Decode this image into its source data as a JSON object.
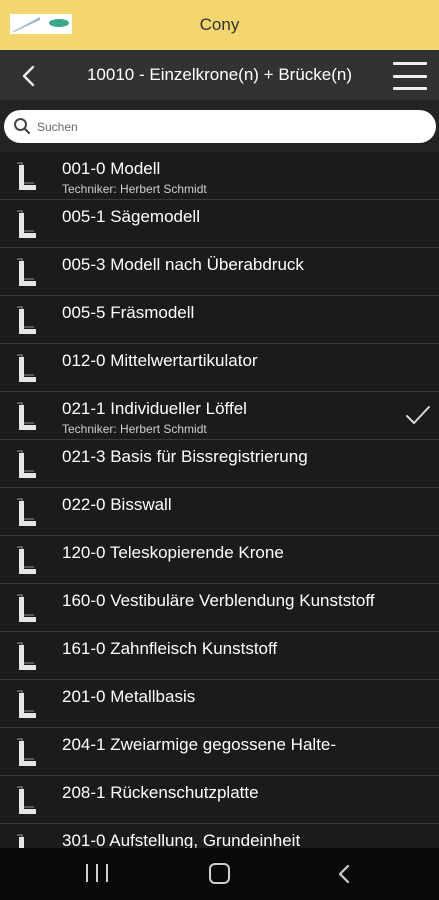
{
  "app": {
    "title": "Cony"
  },
  "header": {
    "title": "10010 - Einzelkrone(n) + Brücke(n)"
  },
  "search": {
    "placeholder": "Suchen",
    "value": ""
  },
  "list": {
    "items": [
      {
        "title": "001-0 Modell",
        "subtitle": "Techniker: Herbert Schmidt",
        "checked": false
      },
      {
        "title": "005-1 Sägemodell",
        "subtitle": "",
        "checked": false
      },
      {
        "title": "005-3 Modell nach Überabdruck",
        "subtitle": "",
        "checked": false
      },
      {
        "title": "005-5 Fräsmodell",
        "subtitle": "",
        "checked": false
      },
      {
        "title": "012-0 Mittelwertartikulator",
        "subtitle": "",
        "checked": false
      },
      {
        "title": "021-1 Individueller Löffel",
        "subtitle": "Techniker: Herbert Schmidt",
        "checked": true
      },
      {
        "title": "021-3 Basis für Bissregistrierung",
        "subtitle": "",
        "checked": false
      },
      {
        "title": "022-0 Bisswall",
        "subtitle": "",
        "checked": false
      },
      {
        "title": "120-0 Teleskopierende Krone",
        "subtitle": "",
        "checked": false
      },
      {
        "title": "160-0 Vestibuläre Verblendung Kunststoff",
        "subtitle": "",
        "checked": false
      },
      {
        "title": "161-0 Zahnfleisch Kunststoff",
        "subtitle": "",
        "checked": false
      },
      {
        "title": "201-0 Metallbasis",
        "subtitle": "",
        "checked": false
      },
      {
        "title": "204-1 Zweiarmige gegossene Halte-",
        "subtitle": "",
        "checked": false
      },
      {
        "title": "208-1 Rückenschutzplatte",
        "subtitle": "",
        "checked": false
      },
      {
        "title": "301-0 Aufstellung, Grundeinheit",
        "subtitle": "",
        "checked": false
      }
    ]
  },
  "icons": {
    "back": "chevron-left-icon",
    "menu": "hamburger-menu-icon",
    "search": "search-icon",
    "item": "l-letter-icon",
    "check": "checkmark-icon",
    "nav_recent": "recent-apps-icon",
    "nav_home": "home-icon",
    "nav_back": "nav-back-icon"
  },
  "colors": {
    "topbar": "#f3d66f",
    "header": "#323232",
    "list_bg": "#1b1b1b",
    "logo_accent": "#3aa88a"
  }
}
